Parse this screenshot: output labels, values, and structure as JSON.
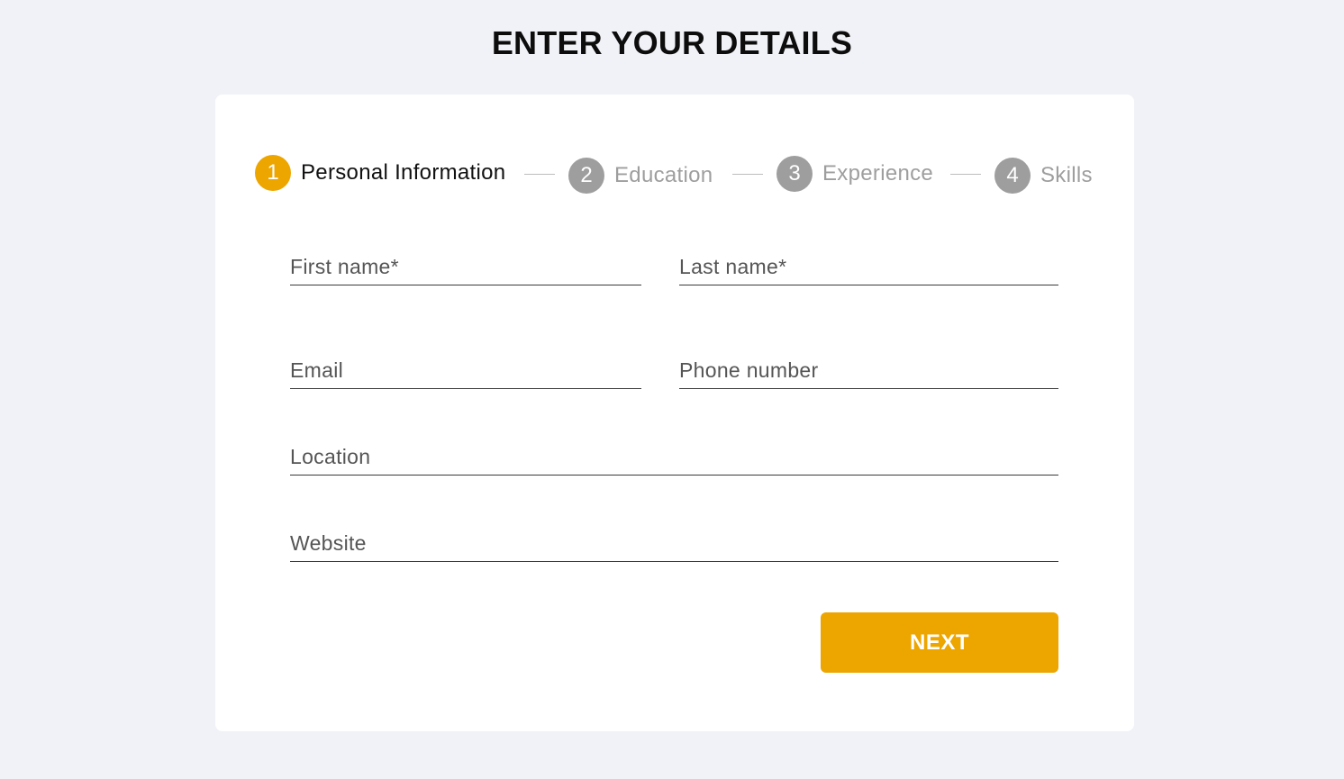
{
  "page": {
    "title": "ENTER YOUR DETAILS"
  },
  "stepper": {
    "active_color": "#eda500",
    "inactive_color": "#9e9e9e",
    "active_text_color": "#111111",
    "inactive_text_color": "#9e9e9e",
    "steps": [
      {
        "number": "1",
        "label": "Personal Information",
        "active": true
      },
      {
        "number": "2",
        "label": "Education",
        "active": false
      },
      {
        "number": "3",
        "label": "Experience",
        "active": false
      },
      {
        "number": "4",
        "label": "Skills",
        "active": false
      }
    ]
  },
  "form": {
    "first_name": {
      "placeholder": "First name*",
      "value": ""
    },
    "last_name": {
      "placeholder": "Last name*",
      "value": ""
    },
    "email": {
      "placeholder": "Email",
      "value": ""
    },
    "phone": {
      "placeholder": "Phone number",
      "value": ""
    },
    "location": {
      "placeholder": "Location",
      "value": ""
    },
    "website": {
      "placeholder": "Website",
      "value": ""
    }
  },
  "actions": {
    "next_label": "NEXT",
    "button_color": "#eda500"
  }
}
